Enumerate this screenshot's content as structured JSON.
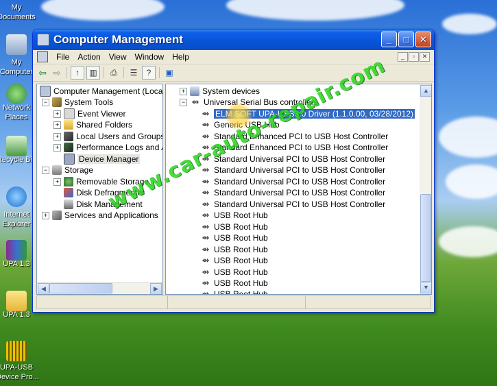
{
  "desktop": {
    "icons": [
      {
        "label": "My\nDocuments"
      },
      {
        "label": "My\nComputer"
      },
      {
        "label": "Network\nPlaces"
      },
      {
        "label": "Recycle Bin"
      },
      {
        "label": "Internet\nExplorer"
      },
      {
        "label": "UPA 1.3"
      },
      {
        "label": "UPA 1.3"
      },
      {
        "label": "UPA-USB\nDevice Pro..."
      }
    ]
  },
  "window": {
    "title": "Computer Management",
    "menu": [
      "File",
      "Action",
      "View",
      "Window",
      "Help"
    ]
  },
  "left_tree": [
    {
      "label": "Computer Management (Local",
      "expander": "",
      "indent": 0
    },
    {
      "label": "System Tools",
      "expander": "−",
      "indent": 1
    },
    {
      "label": "Event Viewer",
      "expander": "+",
      "indent": 2
    },
    {
      "label": "Shared Folders",
      "expander": "+",
      "indent": 2
    },
    {
      "label": "Local Users and Groups",
      "expander": "+",
      "indent": 2
    },
    {
      "label": "Performance Logs and A",
      "expander": "+",
      "indent": 2
    },
    {
      "label": "Device Manager",
      "expander": "",
      "indent": 2
    },
    {
      "label": "Storage",
      "expander": "−",
      "indent": 1
    },
    {
      "label": "Removable Storage",
      "expander": "+",
      "indent": 2
    },
    {
      "label": "Disk Defragmenter",
      "expander": "",
      "indent": 2
    },
    {
      "label": "Disk Management",
      "expander": "",
      "indent": 2
    },
    {
      "label": "Services and Applications",
      "expander": "+",
      "indent": 1
    }
  ],
  "right_tree": {
    "system_devices": "System devices",
    "usb_controllers": "Universal Serial Bus controllers",
    "devices": [
      "ELM SOFT UPA-USB3.0 Driver (1.1.0.00, 03/28/2012)",
      "Generic USB Hub",
      "Standard Enhanced PCI to USB Host Controller",
      "Standard Enhanced PCI to USB Host Controller",
      "Standard Universal PCI to USB Host Controller",
      "Standard Universal PCI to USB Host Controller",
      "Standard Universal PCI to USB Host Controller",
      "Standard Universal PCI to USB Host Controller",
      "Standard Universal PCI to USB Host Controller",
      "USB Root Hub",
      "USB Root Hub",
      "USB Root Hub",
      "USB Root Hub",
      "USB Root Hub",
      "USB Root Hub",
      "USB Root Hub",
      "USB Root Hub"
    ]
  },
  "watermark": "www.car-auto-repair.com",
  "colors": {
    "selection": "#316ac5",
    "titlebar": "#0754d8",
    "watermark": "#2bd31f"
  }
}
